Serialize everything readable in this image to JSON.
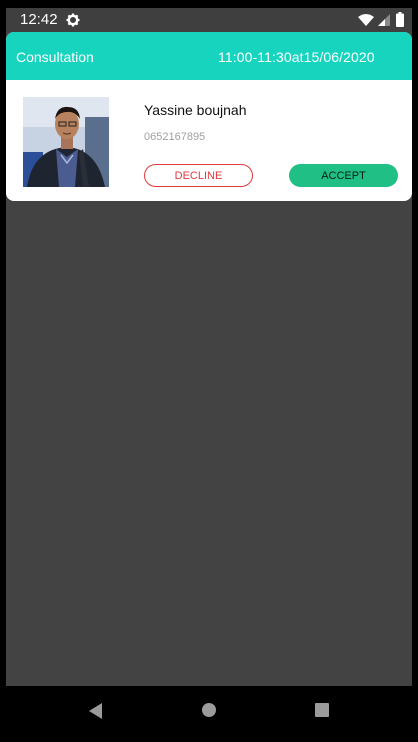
{
  "status_bar": {
    "time": "12:42",
    "icons": [
      "gear-icon",
      "wifi-icon",
      "signal-icon",
      "battery-icon"
    ]
  },
  "consultation_card": {
    "header_title": "Consultation",
    "header_datetime": "11:00-11:30at15/06/2020",
    "header_color": "#17d4bf",
    "user_name": "Yassine boujnah",
    "user_phone": "0652167895",
    "decline_label": "DECLINE",
    "accept_label": "ACCEPT",
    "decline_color": "#e0393e",
    "accept_color": "#1fbf86"
  },
  "nav_bar": {
    "icons": [
      "back-icon",
      "home-icon",
      "recents-icon"
    ]
  }
}
